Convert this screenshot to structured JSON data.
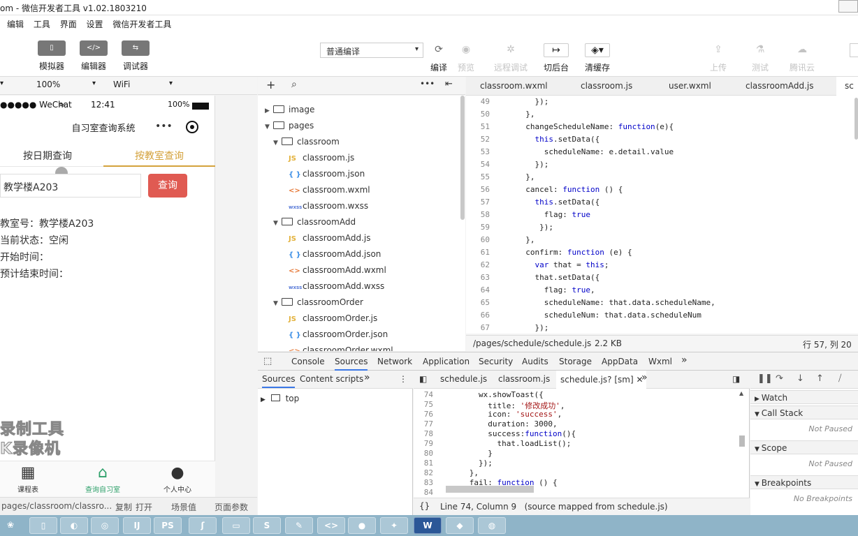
{
  "window": {
    "title": "om - 微信开发者工具 v1.02.1803210"
  },
  "menu": [
    "编辑",
    "工具",
    "界面",
    "设置",
    "微信开发者工具"
  ],
  "toolbar": {
    "simulator": "模拟器",
    "editor": "编辑器",
    "debugger": "调试器",
    "compile_mode": "普通编译",
    "compile": "编译",
    "preview": "预览",
    "remote_debug": "远程调试",
    "background": "切后台",
    "clear_cache": "清缓存",
    "upload": "上传",
    "test": "测试",
    "tencent_cloud": "腾讯云"
  },
  "simulator": {
    "zoom": "100%",
    "network": "WiFi",
    "status": {
      "carrier": "●●●●● WeChat",
      "wifi": "≈",
      "time": "12:41",
      "battery": "100%"
    },
    "nav_title": "自习室查询系统",
    "tabs": [
      "按日期查询",
      "按教室查询"
    ],
    "input_value": "教学楼A203",
    "query_button": "查询",
    "info": [
      "教室号：教学楼A203",
      "当前状态：空闲",
      "开始时间：",
      "预计结束时间："
    ],
    "watermark": [
      "录制工具",
      "K录像机"
    ],
    "tabbar": [
      "课程表",
      "查询自习室",
      "个人中心"
    ],
    "footer": {
      "path": "pages/classroom/classro...",
      "copy": "复制",
      "open": "打开",
      "scene": "场景值",
      "params": "页面参数"
    }
  },
  "filetree": [
    {
      "name": "image",
      "kind": "folder",
      "open": false
    },
    {
      "name": "pages",
      "kind": "folder",
      "open": true
    },
    {
      "name": "classroom",
      "kind": "folder",
      "open": true
    },
    {
      "name": "classroom.js",
      "kind": "js"
    },
    {
      "name": "classroom.json",
      "kind": "json"
    },
    {
      "name": "classroom.wxml",
      "kind": "wxml"
    },
    {
      "name": "classroom.wxss",
      "kind": "wxss"
    },
    {
      "name": "classroomAdd",
      "kind": "folder",
      "open": true
    },
    {
      "name": "classroomAdd.js",
      "kind": "js"
    },
    {
      "name": "classroomAdd.json",
      "kind": "json"
    },
    {
      "name": "classroomAdd.wxml",
      "kind": "wxml"
    },
    {
      "name": "classroomAdd.wxss",
      "kind": "wxss"
    },
    {
      "name": "classroomOrder",
      "kind": "folder",
      "open": true
    },
    {
      "name": "classroomOrder.js",
      "kind": "js"
    },
    {
      "name": "classroomOrder.json",
      "kind": "json"
    },
    {
      "name": "classroomOrder.wxml",
      "kind": "wxml"
    }
  ],
  "editor_tabs": [
    "classroom.wxml",
    "classroom.js",
    "user.wxml",
    "classroomAdd.js",
    "sc"
  ],
  "editor_lines": [
    {
      "n": "49",
      "t": "    });"
    },
    {
      "n": "50",
      "t": "  },"
    },
    {
      "n": "51",
      "t": "  changeScheduleName: function(e){"
    },
    {
      "n": "52",
      "t": "    this.setData({"
    },
    {
      "n": "53",
      "t": "      scheduleName: e.detail.value"
    },
    {
      "n": "54",
      "t": "    });"
    },
    {
      "n": "55",
      "t": "  },"
    },
    {
      "n": "56",
      "t": "  cancel: function () {"
    },
    {
      "n": "57",
      "t": "    this.setData({"
    },
    {
      "n": "58",
      "t": "      flag: true"
    },
    {
      "n": "59",
      "t": "     });"
    },
    {
      "n": "60",
      "t": "  },"
    },
    {
      "n": "61",
      "t": "  confirm: function (e) {"
    },
    {
      "n": "62",
      "t": "    var that = this;"
    },
    {
      "n": "63",
      "t": "    that.setData({"
    },
    {
      "n": "64",
      "t": "      flag: true,"
    },
    {
      "n": "65",
      "t": "      scheduleName: that.data.scheduleName,"
    },
    {
      "n": "66",
      "t": "      scheduleNum: that.data.scheduleNum"
    },
    {
      "n": "67",
      "t": "    });"
    }
  ],
  "editor_status": {
    "path": "/pages/schedule/schedule.js",
    "size": "2.2 KB",
    "pos": "行 57, 列 20"
  },
  "devtools": {
    "tabs": [
      "Console",
      "Sources",
      "Network",
      "Application",
      "Security",
      "Audits",
      "Storage",
      "AppData",
      "Wxml",
      "»"
    ],
    "left_tabs": [
      "Sources",
      "Content scripts",
      "»"
    ],
    "tree_top": "top",
    "file_tabs": [
      "schedule.js",
      "classroom.js",
      "schedule.js? [sm]"
    ],
    "source_lines": [
      {
        "n": "74",
        "t": "        wx.showToast({"
      },
      {
        "n": "75",
        "t": "          title: '修改成功',"
      },
      {
        "n": "76",
        "t": "          icon: 'success',"
      },
      {
        "n": "77",
        "t": "          duration: 3000,"
      },
      {
        "n": "78",
        "t": "          success:function(){"
      },
      {
        "n": "79",
        "t": "            that.loadList();"
      },
      {
        "n": "80",
        "t": "          }"
      },
      {
        "n": "81",
        "t": "        });"
      },
      {
        "n": "82",
        "t": "      },"
      },
      {
        "n": "83",
        "t": "      fail: function () {"
      },
      {
        "n": "84",
        "t": ""
      }
    ],
    "source_status": "Line 74, Column 9   (source mapped from schedule.js)",
    "braces": "{}",
    "panes": [
      {
        "title": "Watch",
        "value": ""
      },
      {
        "title": "Call Stack",
        "value": "Not Paused"
      },
      {
        "title": "Scope",
        "value": "Not Paused"
      },
      {
        "title": "Breakpoints",
        "value": "No Breakpoints"
      }
    ]
  },
  "taskbar": [
    "W"
  ]
}
